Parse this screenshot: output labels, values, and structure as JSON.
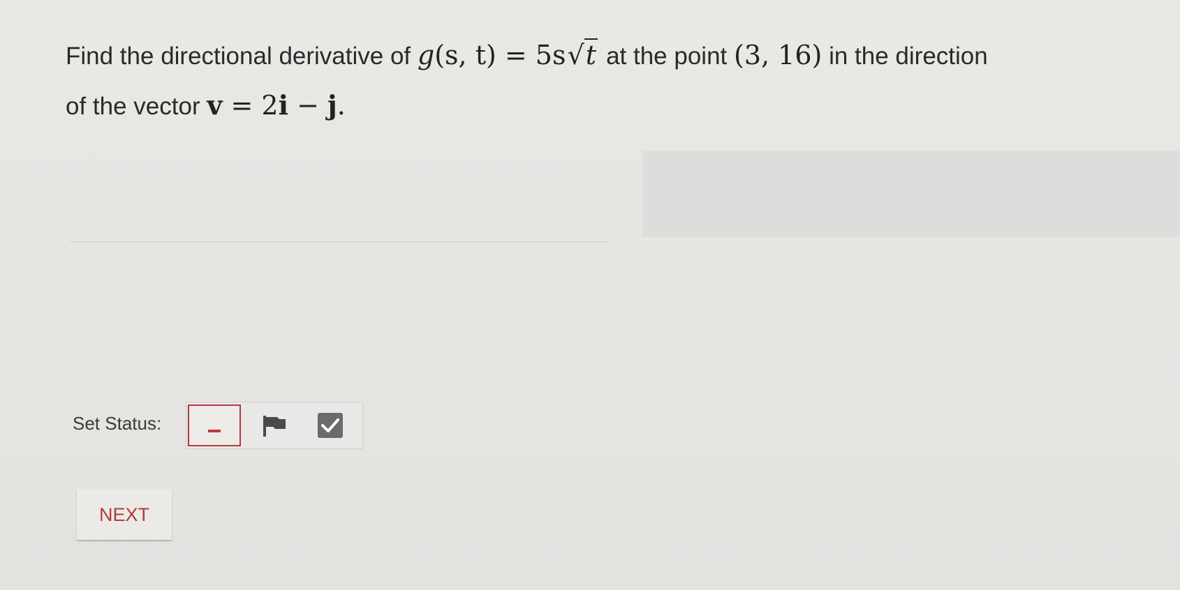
{
  "question": {
    "line1_text_a": "Find the directional derivative of ",
    "func_g": "g",
    "func_args": "(s, t) = 5s",
    "func_sqrt_arg": "t",
    "line1_text_b": " at the point ",
    "point": "(3, 16)",
    "line1_text_c": " in the direction",
    "line2_text_a": "of the vector ",
    "vec_v": "v",
    "vec_eq": " = 2",
    "vec_i": "i",
    "vec_minus": " − ",
    "vec_j": "j",
    "line2_end": "."
  },
  "status": {
    "label": "Set Status:",
    "options": [
      "unanswered",
      "flagged",
      "answered"
    ],
    "selected": "unanswered"
  },
  "next_label": "NEXT",
  "colors": {
    "accent_red": "#b5373d",
    "checkbox_gray": "#6b6b6b"
  }
}
